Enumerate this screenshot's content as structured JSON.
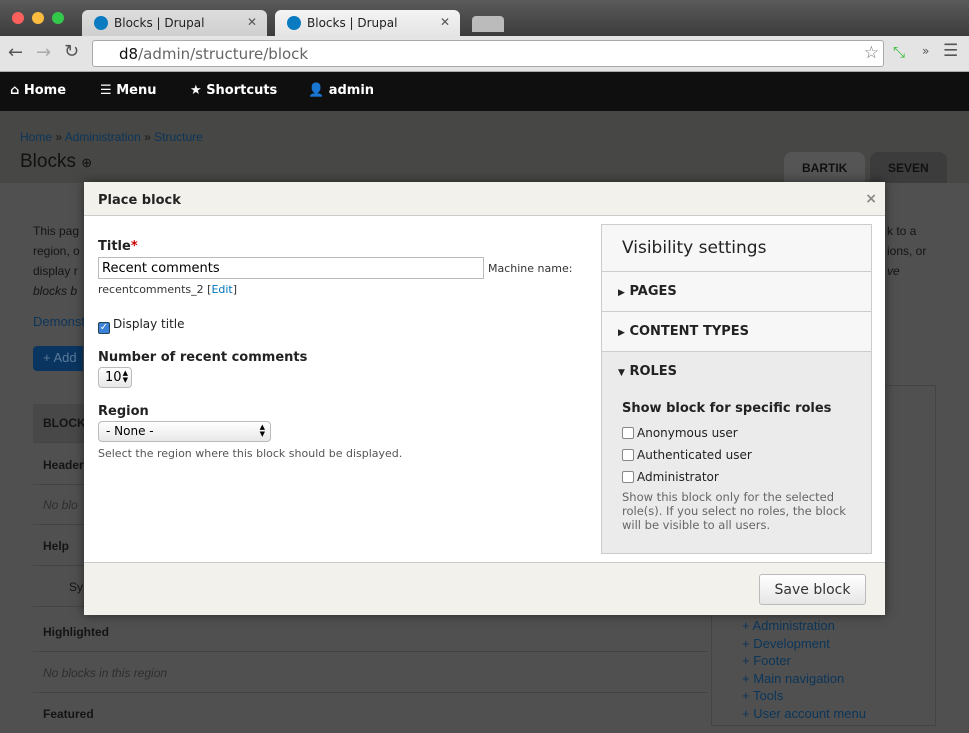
{
  "browser": {
    "tabs": [
      {
        "title": "Blocks | Drupal"
      },
      {
        "title": "Blocks | Drupal"
      }
    ],
    "url_host": "d8",
    "url_path": "/admin/structure/block"
  },
  "admin_toolbar": {
    "items": [
      {
        "label": "Home",
        "icon": "home-icon"
      },
      {
        "label": "Menu",
        "icon": "menu-icon"
      },
      {
        "label": "Shortcuts",
        "icon": "star-icon"
      },
      {
        "label": "admin",
        "icon": "user-icon"
      }
    ]
  },
  "page": {
    "breadcrumb": [
      "Home",
      "Administration",
      "Structure"
    ],
    "breadcrumb_sep": "»",
    "title": "Blocks",
    "theme_tabs": [
      "BARTIK",
      "SEVEN"
    ],
    "intro_left": [
      "This pag",
      "region, o",
      "display r",
      "blocks b"
    ],
    "intro_right": [
      "k to a",
      "ions, or",
      "ve"
    ],
    "demo_link": "Demonst",
    "add_button": "+ Add",
    "table_rows": [
      "BLOCK",
      "Header",
      "No blo",
      "Help",
      "Sy",
      "Highlighted",
      "No blocks in this region",
      "Featured"
    ],
    "sidebar_links": [
      "+ Administration",
      "+ Development",
      "+ Footer",
      "+ Main navigation",
      "+ Tools",
      "+ User account menu"
    ]
  },
  "dialog": {
    "title": "Place block",
    "close": "×",
    "title_label": "Title",
    "required_mark": "*",
    "title_value": "Recent comments",
    "machine_name_label": "Machine name:",
    "machine_name": "recentcomments_2",
    "edit_link": "Edit",
    "display_title_label": "Display title",
    "display_title_checked": true,
    "count_label": "Number of recent comments",
    "count_value": "10",
    "region_label": "Region",
    "region_value": "- None -",
    "region_help": "Select the region where this block should be displayed.",
    "visibility": {
      "heading": "Visibility settings",
      "sections": [
        {
          "label": "PAGES",
          "expanded": false
        },
        {
          "label": "CONTENT TYPES",
          "expanded": false
        },
        {
          "label": "ROLES",
          "expanded": true
        }
      ],
      "roles_heading": "Show block for specific roles",
      "roles": [
        {
          "label": "Anonymous user",
          "checked": false
        },
        {
          "label": "Authenticated user",
          "checked": false
        },
        {
          "label": "Administrator",
          "checked": false
        }
      ],
      "roles_help": "Show this block only for the selected role(s). If you select no roles, the block will be visible to all users."
    },
    "save_button": "Save block"
  }
}
